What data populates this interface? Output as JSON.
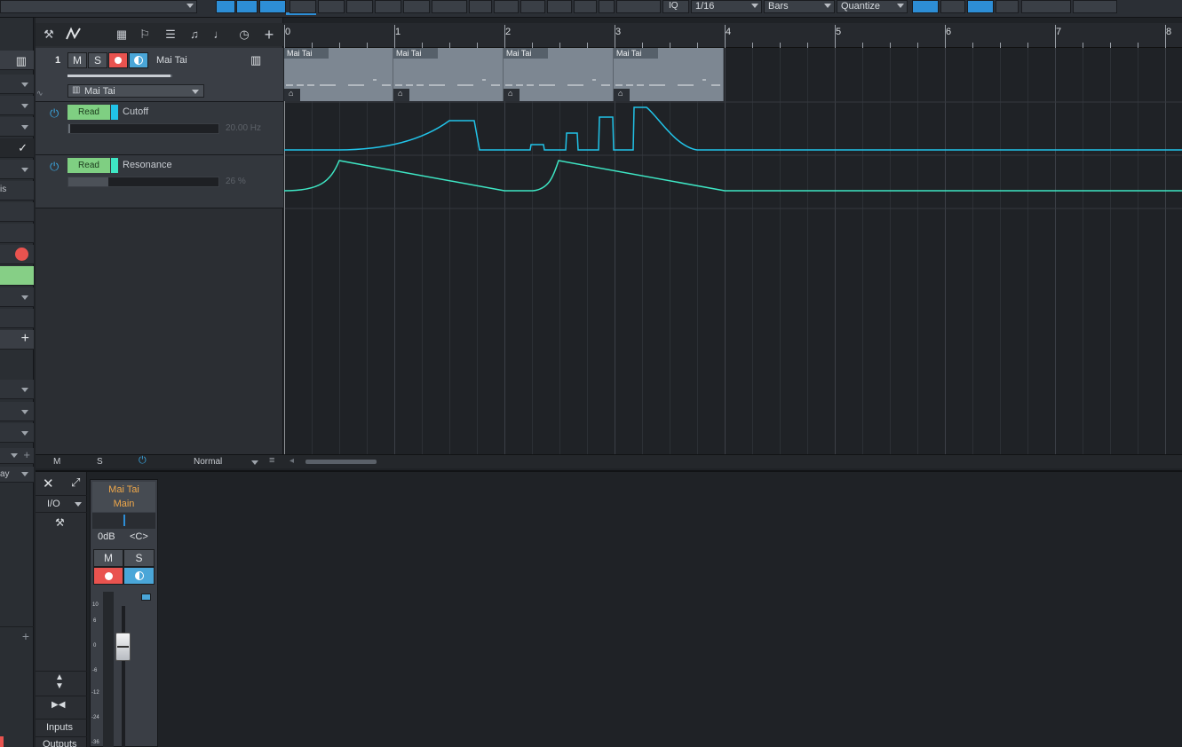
{
  "toolbar": {
    "grid_value": "1/16",
    "timebase": "Bars",
    "quantize_label": "Quantize",
    "iq_label": "IQ"
  },
  "ruler": {
    "bars": [
      "0",
      "1",
      "2",
      "3",
      "4",
      "5",
      "6",
      "7",
      "8"
    ]
  },
  "track": {
    "number": "1",
    "mute": "M",
    "solo": "S",
    "name": "Mai Tai",
    "instrument": "Mai Tai",
    "lanes": [
      {
        "mode": "Read",
        "param": "Cutoff",
        "value": "20.00 Hz",
        "color": "#21c3e8"
      },
      {
        "mode": "Read",
        "param": "Resonance",
        "value": "26 %",
        "color": "#3ee6c4"
      }
    ]
  },
  "clips": [
    "Mai Tai",
    "Mai Tai",
    "Mai Tai",
    "Mai Tai"
  ],
  "footer": {
    "mute": "M",
    "solo": "S",
    "mode": "Normal"
  },
  "mixer": {
    "io": "I/O",
    "inputs": "Inputs",
    "outputs": "Outputs",
    "channel": {
      "name": "Mai Tai",
      "bus": "Main",
      "gain": "0dB",
      "pan": "<C>",
      "mute": "M",
      "solo": "S",
      "scale": [
        "10",
        "6",
        "0",
        "-6",
        "-12",
        "-24",
        "-36"
      ]
    }
  },
  "leftstrip": {
    "partial_a": "is",
    "partial_b": "ay"
  },
  "colors": {
    "accent": "#2d8ed6",
    "read": "#7fcf82",
    "record": "#e9534f",
    "monitor": "#4aa6d8",
    "cutoff": "#21c3e8",
    "resonance": "#3ee6c4"
  }
}
